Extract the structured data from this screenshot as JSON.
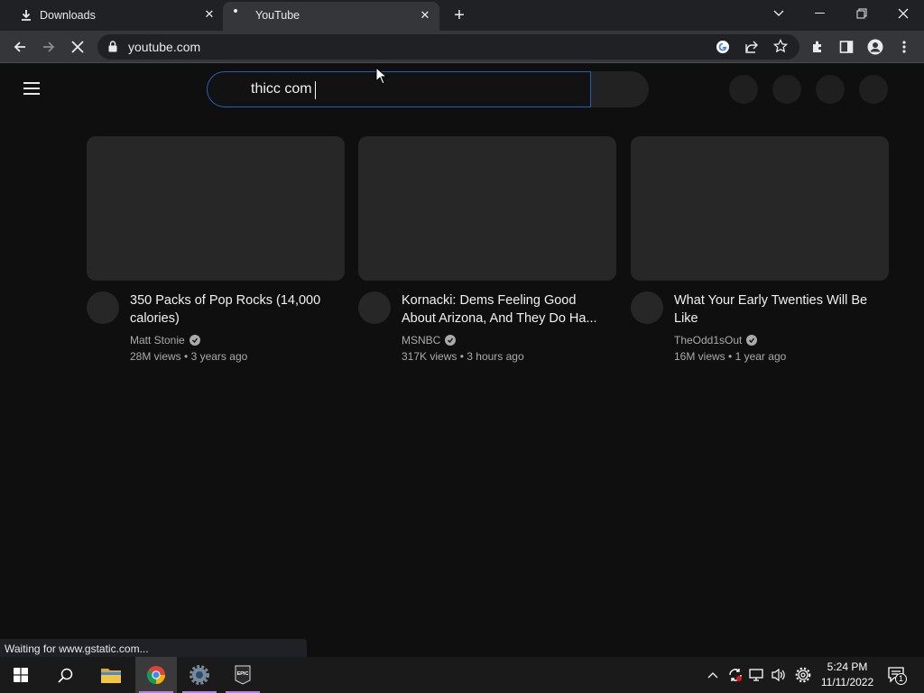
{
  "browser": {
    "tabs": [
      {
        "title": "Downloads",
        "icon": "download-icon"
      },
      {
        "title": "YouTube",
        "icon": "loading-icon"
      }
    ],
    "url": "youtube.com",
    "status_text": "Waiting for www.gstatic.com..."
  },
  "youtube": {
    "search_value": "thicc com",
    "videos": [
      {
        "title": "350 Packs of Pop Rocks (14,000 calories)",
        "channel": "Matt Stonie",
        "views": "28M views",
        "age": "3 years ago"
      },
      {
        "title": "Kornacki: Dems Feeling Good About Arizona, And They Do Ha...",
        "channel": "MSNBC",
        "views": "317K views",
        "age": "3 hours ago"
      },
      {
        "title": "What Your Early Twenties Will Be Like",
        "channel": "TheOdd1sOut",
        "views": "16M views",
        "age": "1 year ago"
      }
    ],
    "meta_separator": "•"
  },
  "taskbar": {
    "time": "5:24 PM",
    "date": "11/11/2022",
    "notification_count": "1",
    "apps": [
      "windows-start-icon",
      "search-icon",
      "file-explorer-icon",
      "chrome-icon",
      "settings-app-icon",
      "epic-games-icon"
    ],
    "epic_label": "EPIC"
  },
  "colors": {
    "accent_blue": "#1c62b9",
    "page_bg": "#0f0f0f",
    "taskbar_highlight": "#b285d6"
  }
}
